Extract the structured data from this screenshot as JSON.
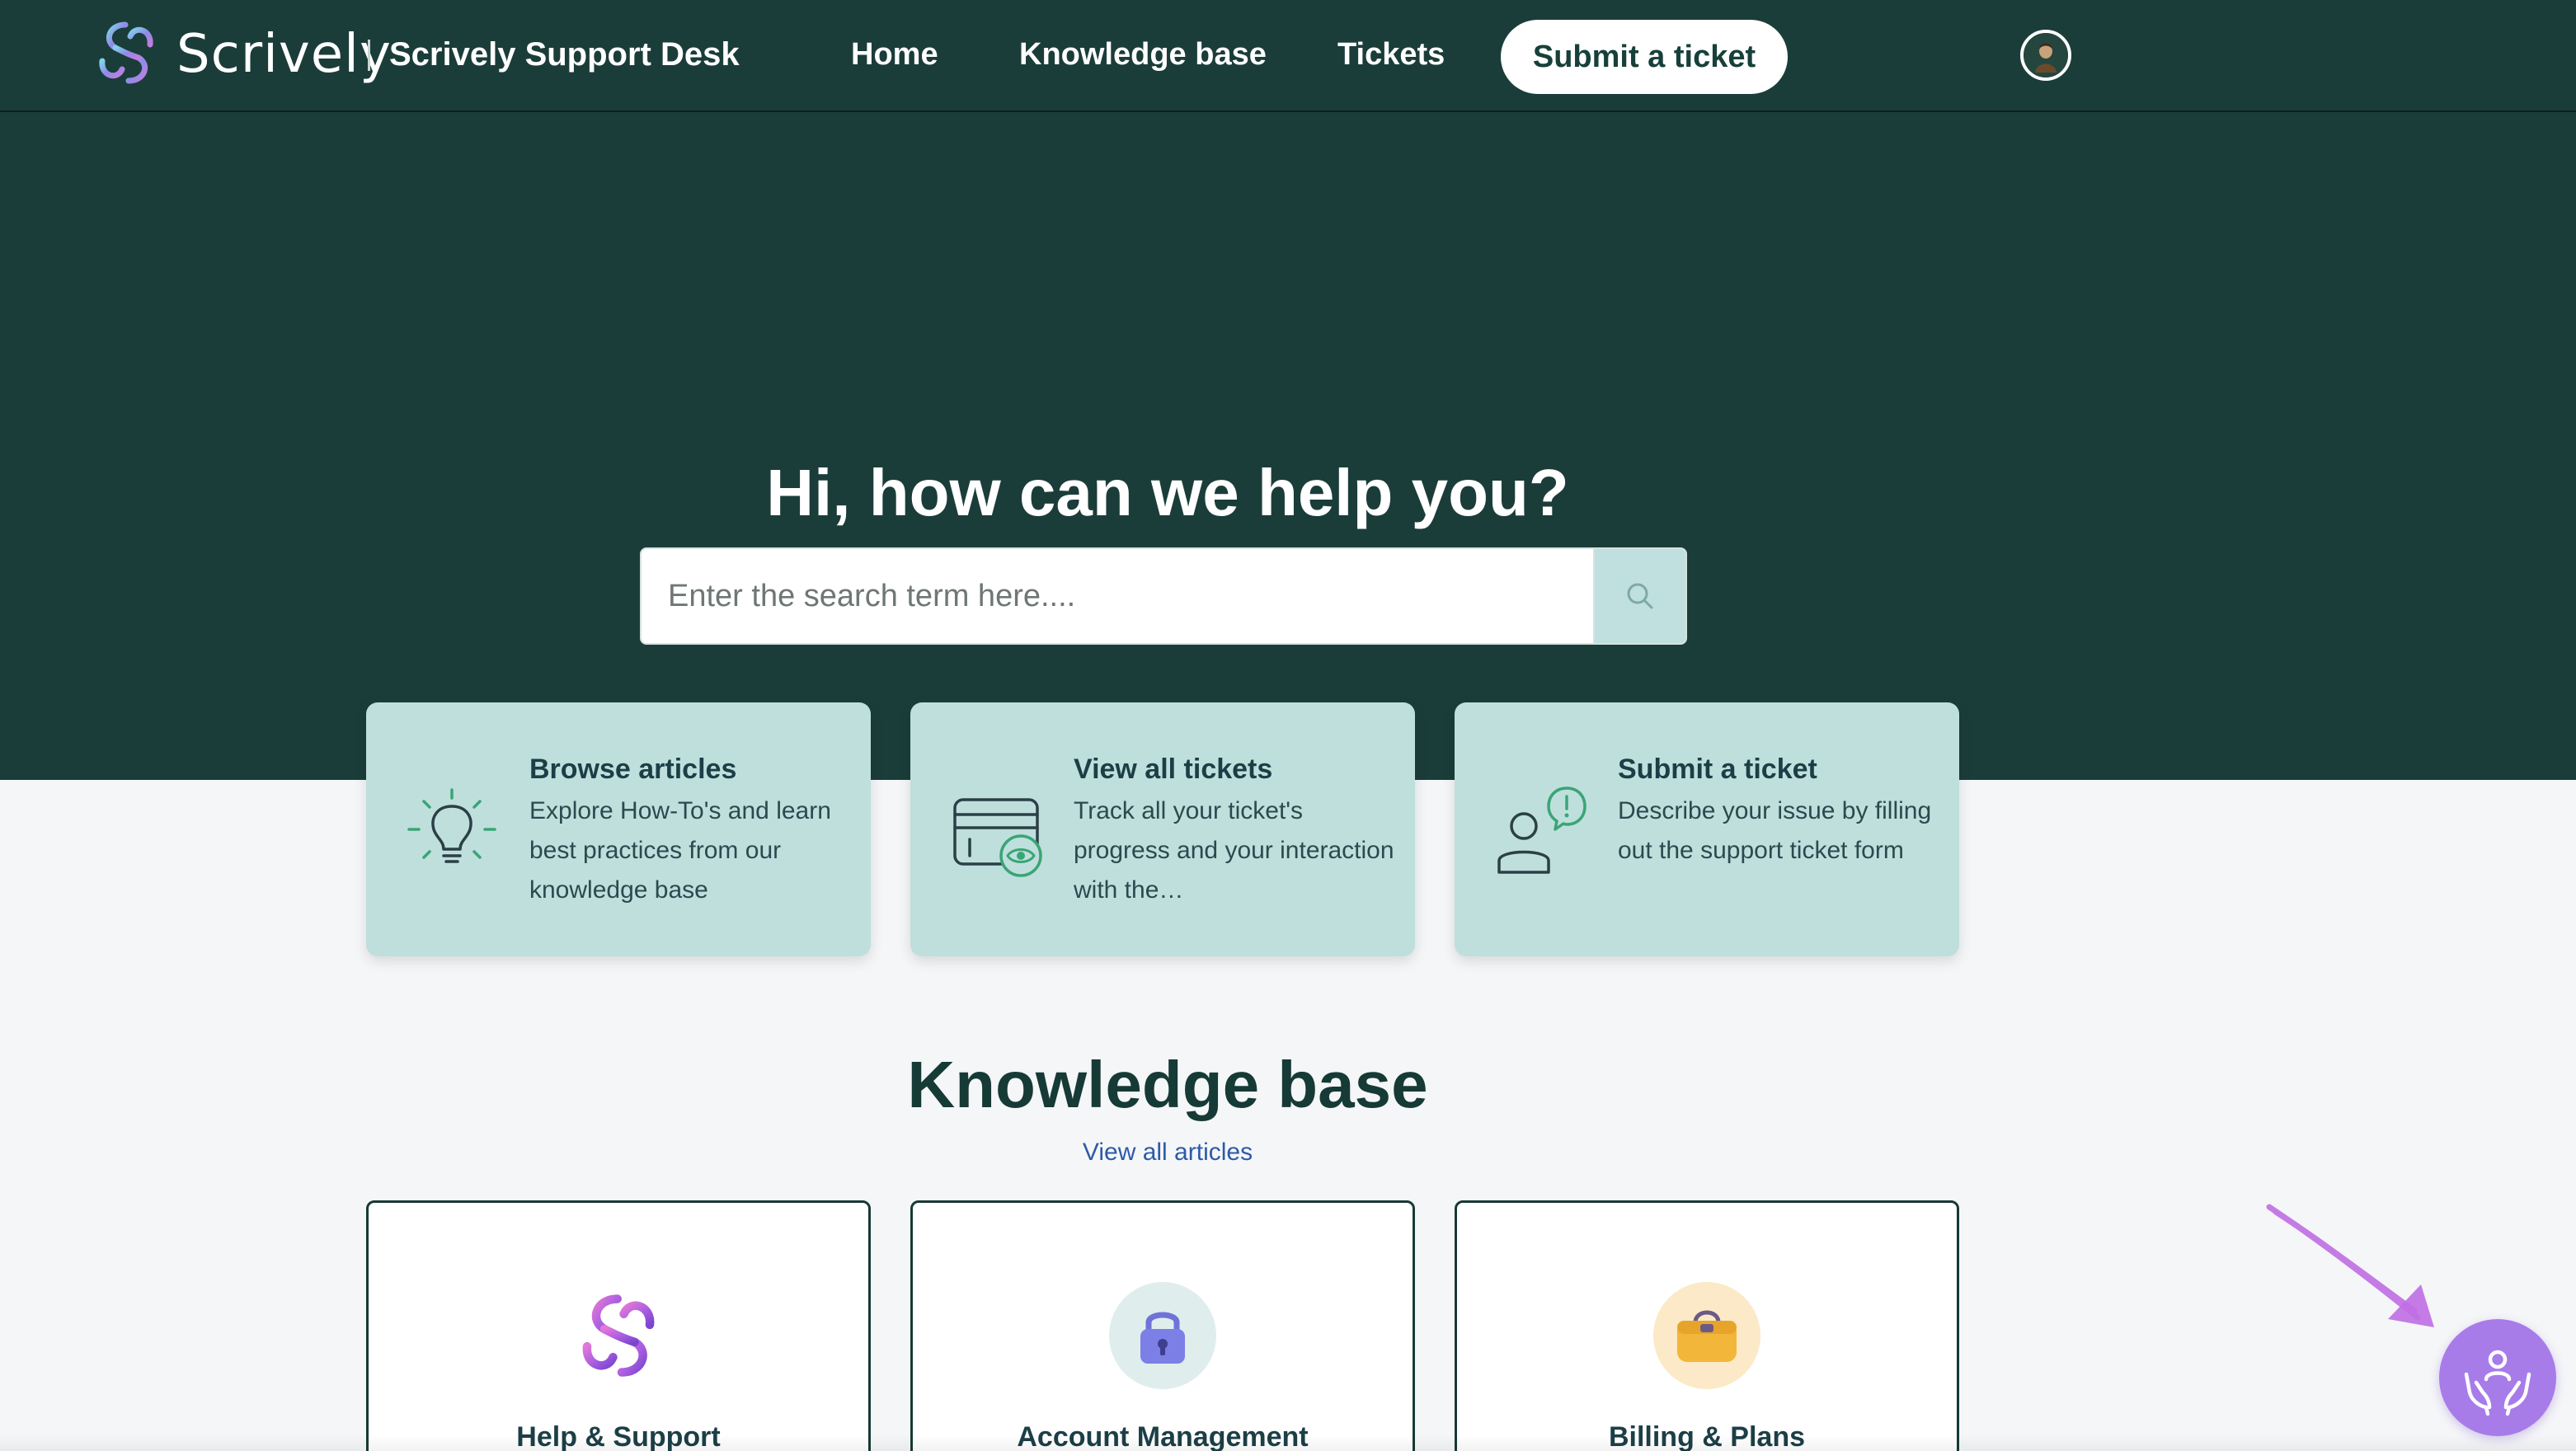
{
  "header": {
    "brand": "Scrively",
    "desk_title": "Scrively Support Desk",
    "nav": {
      "home": "Home",
      "knowledge_base": "Knowledge base",
      "tickets": "Tickets",
      "submit": "Submit a ticket"
    }
  },
  "hero": {
    "title": "Hi, how can we help you?",
    "search": {
      "placeholder": "Enter the search term here....",
      "value": ""
    }
  },
  "quick_actions": [
    {
      "title": "Browse articles",
      "description": "Explore How-To's and learn best practices from our knowledge base",
      "icon": "lightbulb-icon"
    },
    {
      "title": "View all tickets",
      "description": "Track all your ticket's progress and your interaction with the…",
      "icon": "tickets-eye-icon"
    },
    {
      "title": "Submit a ticket",
      "description": "Describe your issue by filling out the support ticket form",
      "icon": "person-alert-icon"
    }
  ],
  "knowledge_base": {
    "title": "Knowledge base",
    "view_all": "View all articles",
    "categories": [
      {
        "label": "Help & Support",
        "icon": "scrively-logo-icon"
      },
      {
        "label": "Account Management",
        "icon": "lock-icon"
      },
      {
        "label": "Billing & Plans",
        "icon": "purse-icon"
      }
    ]
  },
  "colors": {
    "header_bg": "#1b3d39",
    "card_bg": "#bfdfdd",
    "page_bg": "#f5f6f8",
    "link": "#2d5aa8",
    "help_button": "#a77ce9"
  }
}
